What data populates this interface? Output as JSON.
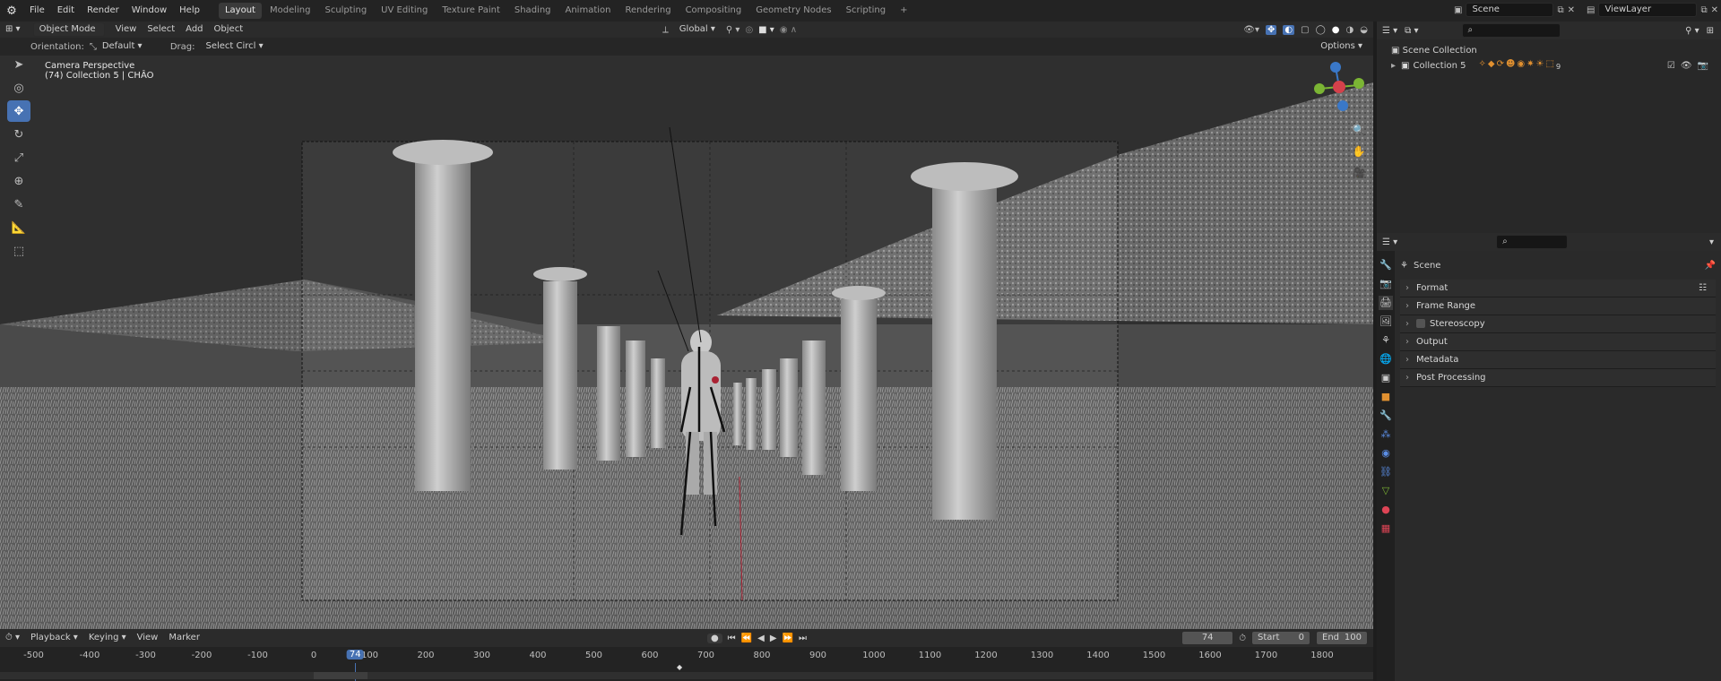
{
  "menu": [
    "File",
    "Edit",
    "Render",
    "Window",
    "Help"
  ],
  "workspaces": [
    "Layout",
    "Modeling",
    "Sculpting",
    "UV Editing",
    "Texture Paint",
    "Shading",
    "Animation",
    "Rendering",
    "Compositing",
    "Geometry Nodes",
    "Scripting"
  ],
  "active_workspace": "Layout",
  "add_workspace": "+",
  "scene_field": "Scene",
  "viewlayer_field": "ViewLayer",
  "viewport_header": {
    "mode": "Object Mode",
    "menus": [
      "View",
      "Select",
      "Add",
      "Object"
    ],
    "transform": "Global",
    "options": "Options"
  },
  "tool_settings": {
    "orientation_label": "Orientation:",
    "orientation_value": "Default",
    "drag_label": "Drag:",
    "drag_value": "Select Circl"
  },
  "viewport_overlay": {
    "line1": "Camera Perspective",
    "line2": "(74) Collection 5 | CHÂO"
  },
  "outliner": {
    "root": "Scene Collection",
    "collection": "Collection 5",
    "extra": "9"
  },
  "properties": {
    "context": "Scene",
    "sections": [
      "Format",
      "Frame Range",
      "Stereoscopy",
      "Output",
      "Metadata",
      "Post Processing"
    ]
  },
  "timeline": {
    "menus": [
      "Playback",
      "Keying",
      "View",
      "Marker"
    ],
    "current_frame": "74",
    "start_label": "Start",
    "start_value": "0",
    "end_label": "End",
    "end_value": "100",
    "ticks": [
      "-500",
      "-400",
      "-300",
      "-200",
      "-100",
      "0",
      "100",
      "200",
      "300",
      "400",
      "500",
      "600",
      "700",
      "800",
      "900",
      "1000",
      "1100",
      "1200",
      "1300",
      "1400",
      "1500",
      "1600",
      "1700",
      "1800"
    ],
    "playhead_label": "74"
  },
  "colors": {
    "accent": "#4772b3",
    "x_axis": "#d4414b",
    "y_axis": "#7bb534",
    "z_axis": "#3a78c8",
    "playhead": "#4772b3"
  }
}
